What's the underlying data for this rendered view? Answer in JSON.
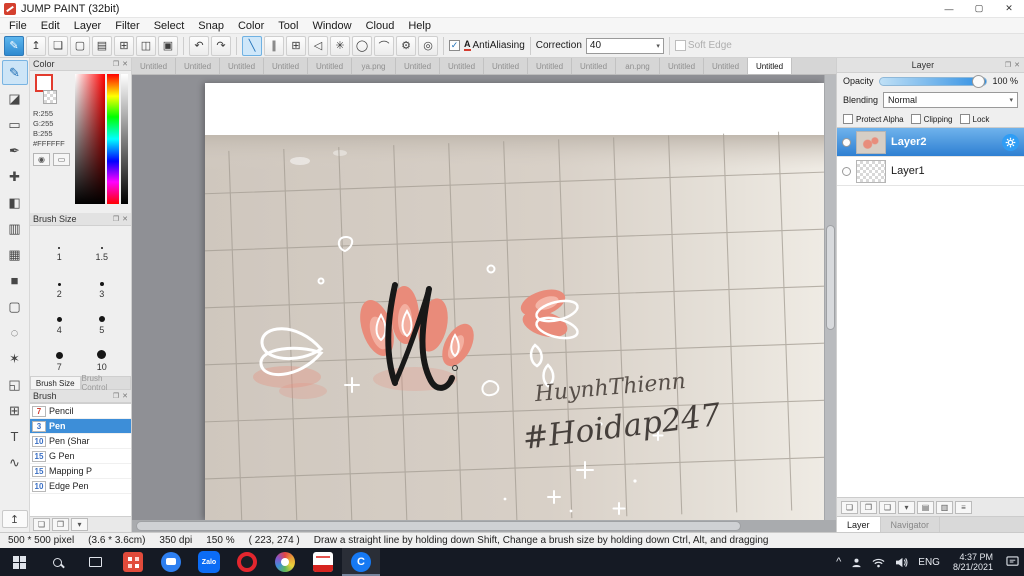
{
  "window": {
    "title": "JUMP PAINT (32bit)",
    "controls": {
      "minimize": "—",
      "maximize": "▢",
      "close": "✕"
    }
  },
  "menu": {
    "items": [
      "File",
      "Edit",
      "Layer",
      "Filter",
      "Select",
      "Snap",
      "Color",
      "Tool",
      "Window",
      "Cloud",
      "Help"
    ]
  },
  "toolbar": {
    "file_icons": [
      {
        "name": "new-canvas",
        "glyph": "✎"
      },
      {
        "name": "export",
        "glyph": "↥"
      },
      {
        "name": "comment",
        "glyph": "❏"
      },
      {
        "name": "monitor",
        "glyph": "▢"
      },
      {
        "name": "paper",
        "glyph": "▤"
      },
      {
        "name": "grid-toggle",
        "glyph": "⊞"
      },
      {
        "name": "panels",
        "glyph": "◫"
      },
      {
        "name": "layout",
        "glyph": "▣"
      }
    ],
    "undo": "↶",
    "redo": "↷",
    "snap_icons": [
      {
        "name": "snap-line",
        "glyph": "╲"
      },
      {
        "name": "snap-parallel",
        "glyph": "∥"
      },
      {
        "name": "snap-cross",
        "glyph": "⊞"
      },
      {
        "name": "snap-vanish",
        "glyph": "◁"
      },
      {
        "name": "snap-radial",
        "glyph": "✳"
      },
      {
        "name": "snap-ellipse",
        "glyph": "◯"
      },
      {
        "name": "snap-curve",
        "glyph": "⌒"
      },
      {
        "name": "snap-settings",
        "glyph": "⚙"
      },
      {
        "name": "snap-off",
        "glyph": "◎"
      }
    ],
    "antialiasing_label": "AntiAliasing",
    "aa_icon": "A",
    "correction_label": "Correction",
    "correction_value": "40",
    "soft_edge_label": "Soft Edge"
  },
  "doc_tabs": [
    "Untitled",
    "Untitled",
    "Untitled",
    "Untitled",
    "Untitled",
    "ya.png",
    "Untitled",
    "Untitled",
    "Untitled",
    "Untitled",
    "Untitled",
    "an.png",
    "Untitled",
    "Untitled",
    "Untitled"
  ],
  "tools": [
    {
      "name": "brush",
      "glyph": "✎"
    },
    {
      "name": "eraser",
      "glyph": "◪"
    },
    {
      "name": "select-rect",
      "glyph": "▭"
    },
    {
      "name": "pen",
      "glyph": "✒"
    },
    {
      "name": "move",
      "glyph": "✚"
    },
    {
      "name": "bucket",
      "glyph": "◧"
    },
    {
      "name": "gradient",
      "glyph": "▥"
    },
    {
      "name": "stamp",
      "glyph": "▦"
    },
    {
      "name": "shape",
      "glyph": "■"
    },
    {
      "name": "marquee",
      "glyph": "▢"
    },
    {
      "name": "lasso",
      "glyph": "◌"
    },
    {
      "name": "magic-wand",
      "glyph": "✶"
    },
    {
      "name": "transform",
      "glyph": "◱"
    },
    {
      "name": "grid-tool",
      "glyph": "⊞"
    },
    {
      "name": "text",
      "glyph": "T"
    },
    {
      "name": "curve",
      "glyph": "∿"
    }
  ],
  "tool_up_glyph": "↥",
  "panel_header_icons": {
    "popout": "❐",
    "close": "✕"
  },
  "color_panel": {
    "title": "Color",
    "r_label": "R:255",
    "g_label": "G:255",
    "b_label": "B:255",
    "hex_label": "#FFFFFF"
  },
  "color_buttons": [
    "◉",
    "▭"
  ],
  "brush_size_panel": {
    "title": "Brush Size",
    "sizes": [
      "1",
      "1.5",
      "2",
      "3",
      "4",
      "5",
      "7",
      "10"
    ]
  },
  "panel_tabs": {
    "brush_size": "Brush Size",
    "brush_control": "Brush Control"
  },
  "brush_panel": {
    "title": "Brush",
    "brushes": [
      {
        "size": "7",
        "name": "Pencil"
      },
      {
        "size": "3",
        "name": "Pen"
      },
      {
        "size": "10",
        "name": "Pen (Shar"
      },
      {
        "size": "15",
        "name": "G Pen"
      },
      {
        "size": "15",
        "name": "Mapping P"
      },
      {
        "size": "10",
        "name": "Edge Pen"
      }
    ]
  },
  "panel_bottom": [
    "❏",
    "❐",
    "▾"
  ],
  "layer_panel": {
    "title": "Layer",
    "opacity_label": "Opacity",
    "opacity_value": "100 %",
    "blending_label": "Blending",
    "blending_value": "Normal",
    "protect_alpha_label": "Protect Alpha",
    "clipping_label": "Clipping",
    "lock_label": "Lock",
    "layers": [
      {
        "name": "Layer2"
      },
      {
        "name": "Layer1"
      }
    ],
    "tab_layer": "Layer",
    "tab_navigator": "Navigator"
  },
  "layer_bottom": [
    "❏",
    "❐",
    "❑",
    "▾",
    "▤",
    "▥",
    "≡"
  ],
  "canvas": {
    "signature_line1": "HuynhThienn",
    "signature_line2": "#Hoidap247"
  },
  "status_bar": {
    "size": "500 * 500 pixel",
    "cm": "(3.6 * 3.6cm)",
    "dpi": "350 dpi",
    "zoom": "150 %",
    "coords": "( 223, 274 )",
    "hint": "Draw a straight line by holding down Shift, Change a brush size by holding down Ctrl, Alt, and dragging"
  },
  "taskbar": {
    "zalo_label": "Zalo",
    "coccoc_letter": "C",
    "tray": {
      "lang": "ENG",
      "time": "4:37 PM",
      "date": "8/21/2021"
    }
  },
  "colors": {
    "accent_blue": "#2f8ad0",
    "salmon": "#e98b7a",
    "selected_layer_top": "#6fb3ec",
    "selected_layer_bottom": "#2e7fd2",
    "taskbar_bg": "#151a24"
  }
}
